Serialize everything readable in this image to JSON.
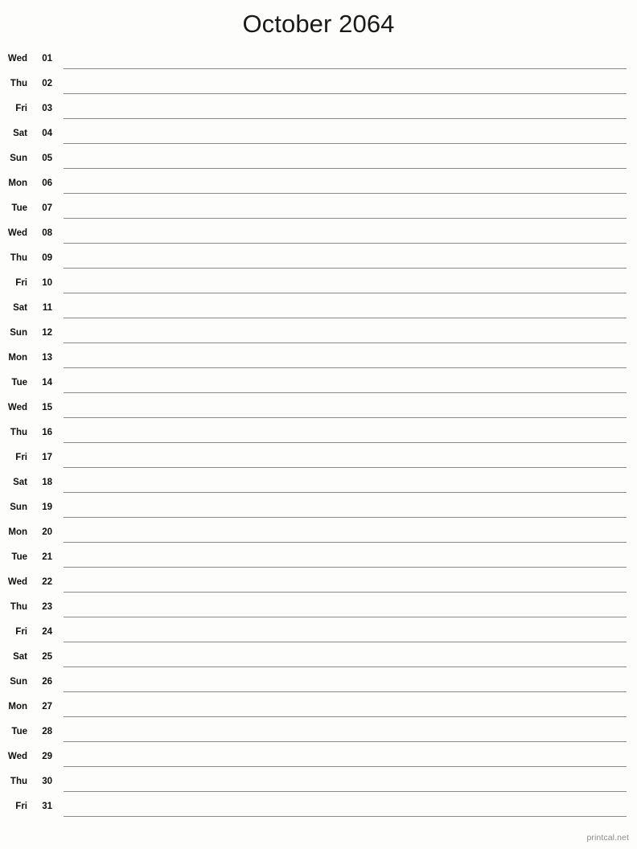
{
  "document": {
    "type": "printable-monthly-calendar",
    "title": "October 2064",
    "month": "October",
    "year": "2064",
    "orientation": "portrait",
    "layout": "single-column-notes-lines"
  },
  "colors": {
    "page_background": "#fdfdfb",
    "text": "#0f0f0f",
    "title_text": "#1a1a1a",
    "rule_line": "#8a8a8a",
    "footer_text": "#8c8c8c"
  },
  "days": [
    {
      "weekday": "Wed",
      "number": "01"
    },
    {
      "weekday": "Thu",
      "number": "02"
    },
    {
      "weekday": "Fri",
      "number": "03"
    },
    {
      "weekday": "Sat",
      "number": "04"
    },
    {
      "weekday": "Sun",
      "number": "05"
    },
    {
      "weekday": "Mon",
      "number": "06"
    },
    {
      "weekday": "Tue",
      "number": "07"
    },
    {
      "weekday": "Wed",
      "number": "08"
    },
    {
      "weekday": "Thu",
      "number": "09"
    },
    {
      "weekday": "Fri",
      "number": "10"
    },
    {
      "weekday": "Sat",
      "number": "11"
    },
    {
      "weekday": "Sun",
      "number": "12"
    },
    {
      "weekday": "Mon",
      "number": "13"
    },
    {
      "weekday": "Tue",
      "number": "14"
    },
    {
      "weekday": "Wed",
      "number": "15"
    },
    {
      "weekday": "Thu",
      "number": "16"
    },
    {
      "weekday": "Fri",
      "number": "17"
    },
    {
      "weekday": "Sat",
      "number": "18"
    },
    {
      "weekday": "Sun",
      "number": "19"
    },
    {
      "weekday": "Mon",
      "number": "20"
    },
    {
      "weekday": "Tue",
      "number": "21"
    },
    {
      "weekday": "Wed",
      "number": "22"
    },
    {
      "weekday": "Thu",
      "number": "23"
    },
    {
      "weekday": "Fri",
      "number": "24"
    },
    {
      "weekday": "Sat",
      "number": "25"
    },
    {
      "weekday": "Sun",
      "number": "26"
    },
    {
      "weekday": "Mon",
      "number": "27"
    },
    {
      "weekday": "Tue",
      "number": "28"
    },
    {
      "weekday": "Wed",
      "number": "29"
    },
    {
      "weekday": "Thu",
      "number": "30"
    },
    {
      "weekday": "Fri",
      "number": "31"
    }
  ],
  "footer": {
    "credit": "printcal.net"
  }
}
